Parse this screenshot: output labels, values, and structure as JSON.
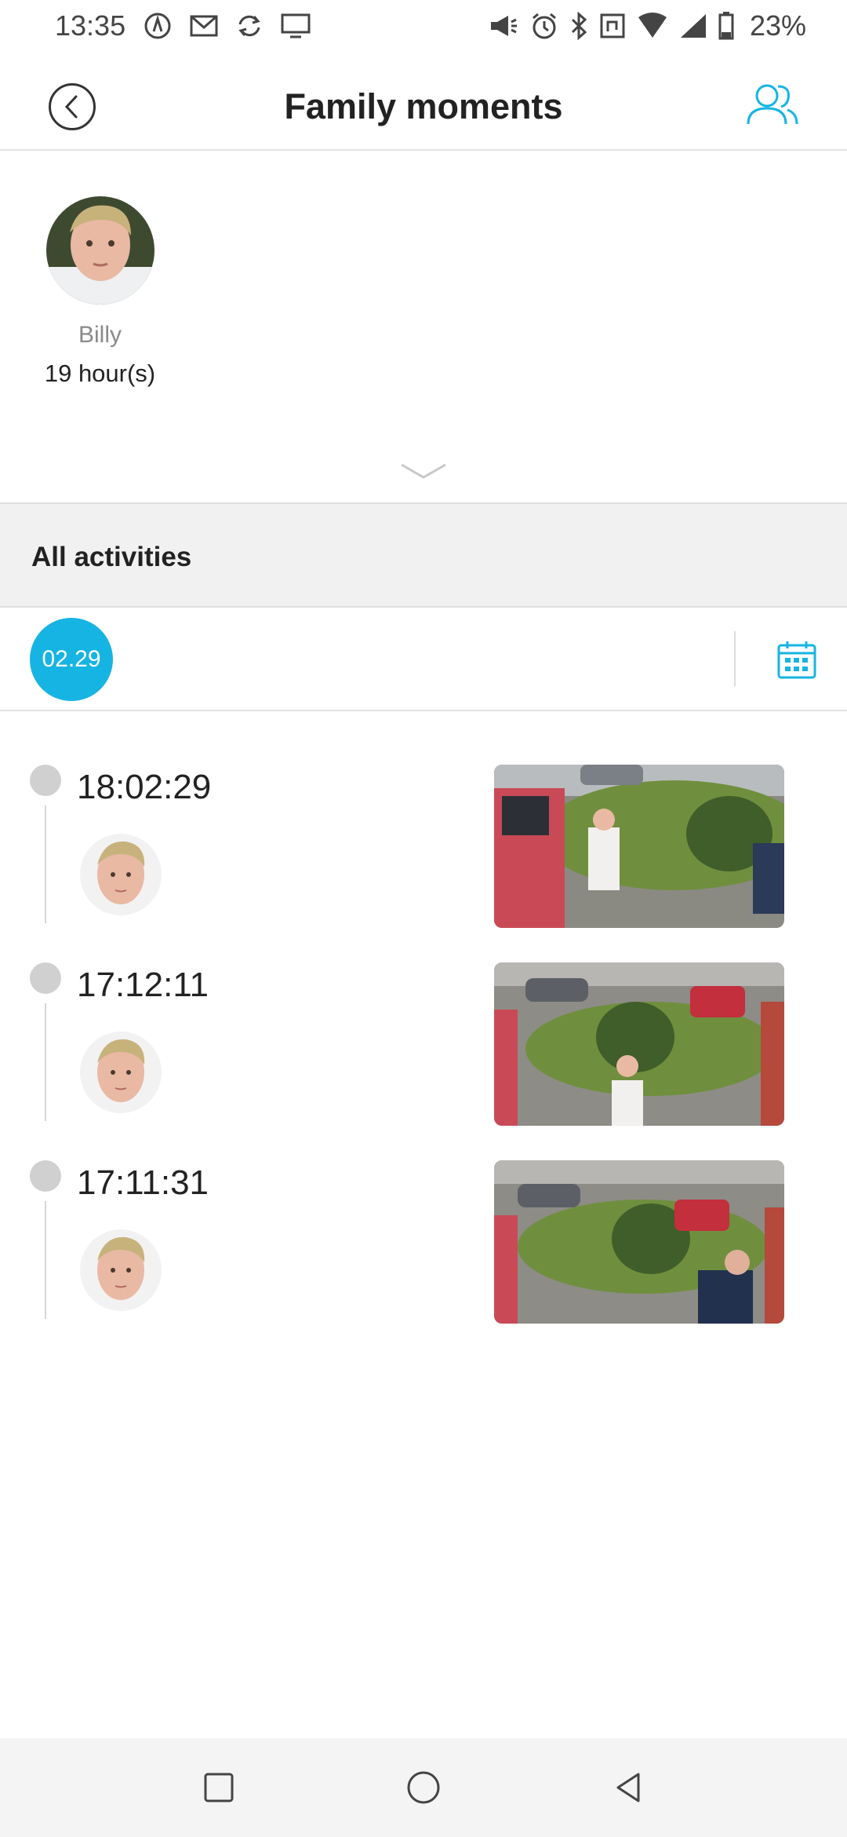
{
  "status_bar": {
    "time": "13:35",
    "battery": "23%"
  },
  "header": {
    "title": "Family moments"
  },
  "member": {
    "name": "Billy",
    "hours": "19 hour(s)"
  },
  "activities": {
    "title": "All activities",
    "date_chip": "02.29",
    "events": [
      {
        "time": "18:02:29"
      },
      {
        "time": "17:12:11"
      },
      {
        "time": "17:11:31"
      }
    ]
  },
  "colors": {
    "accent": "#16b4e2",
    "band": "#f1f1f1"
  }
}
